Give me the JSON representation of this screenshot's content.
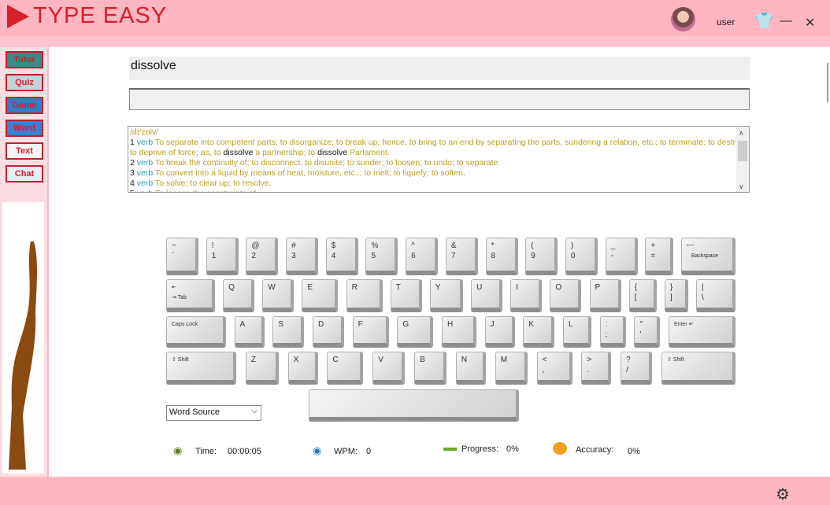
{
  "app": {
    "title": "TYPE EASY",
    "user": "user"
  },
  "nav": [
    {
      "label": "Tutor",
      "bg": "#3a8a8a"
    },
    {
      "label": "Quiz",
      "bg": "#c8d0d8"
    },
    {
      "label": "Game",
      "bg": "#2e7fc8"
    },
    {
      "label": "Word",
      "bg": "#3a7fd0"
    },
    {
      "label": "Text",
      "bg": "#f4f4f4"
    },
    {
      "label": "Chat",
      "bg": "#e8eef4"
    }
  ],
  "word": "dissolve",
  "typed": "",
  "definition": {
    "pron": "/dɪ'zɒlv/",
    "senses": [
      {
        "n": "1",
        "pos": "verb",
        "text": "To separate into competent parts; to disorganize; to break up; hence, to bring to an end by separating the parts, sundering a relation, etc.; to terminate; to destroy; to deprive of force; as, to ",
        "k1": "dissolve",
        "t2": " a partnership; to ",
        "k2": "dissolve",
        "t3": " Parlament."
      },
      {
        "n": "2",
        "pos": "verb",
        "text": "To break the continuity of; to disconnect; to disunite; to sunder; to loosen; to undo; to separate."
      },
      {
        "n": "3",
        "pos": "verb",
        "text": "To convert into a liquid by means of heat, moisture, etc.,; to melt; to liquefy; to soften."
      },
      {
        "n": "4",
        "pos": "verb",
        "text": "To solve; to clear up; to resolve."
      },
      {
        "n": "5",
        "pos": "verb",
        "text": "To loosen the constraints of."
      }
    ]
  },
  "keyboard": {
    "rows": [
      [
        "~\n`",
        "!\n1",
        "@\n2",
        "#\n3",
        "$\n4",
        "%\n5",
        "^\n6",
        "&\n7",
        "*\n8",
        "(\n9",
        ")\n0",
        "_\n-",
        "+\n=",
        "⟵\n   Backspace"
      ],
      [
        "⇤\n⇥ Tab",
        "Q",
        "W",
        "E",
        "R",
        "T",
        "Y",
        "U",
        "I",
        "O",
        "P",
        "{\n[",
        "}\n]",
        "|\n\\"
      ],
      [
        "Caps Lock",
        "A",
        "S",
        "D",
        "F",
        "G",
        "H",
        "J",
        "K",
        "L",
        ":\n;",
        "\"\n'",
        "Enter ↵"
      ],
      [
        "⇧ Shift",
        "Z",
        "X",
        "C",
        "V",
        "B",
        "N",
        "M",
        "<\n,",
        ">\n.",
        "?\n/",
        "⇧ Shift"
      ]
    ],
    "space": ""
  },
  "source_select": "Word Source",
  "stats": {
    "time_label": "Time:",
    "time": "00:00:05",
    "wpm_label": "WPM:",
    "wpm": "0",
    "progress_label": "Progress:",
    "progress": "0%",
    "accuracy_label": "Accuracy:",
    "accuracy": "0%"
  },
  "colors": {
    "title": "#d8202a",
    "background": "#ffb6c1"
  }
}
